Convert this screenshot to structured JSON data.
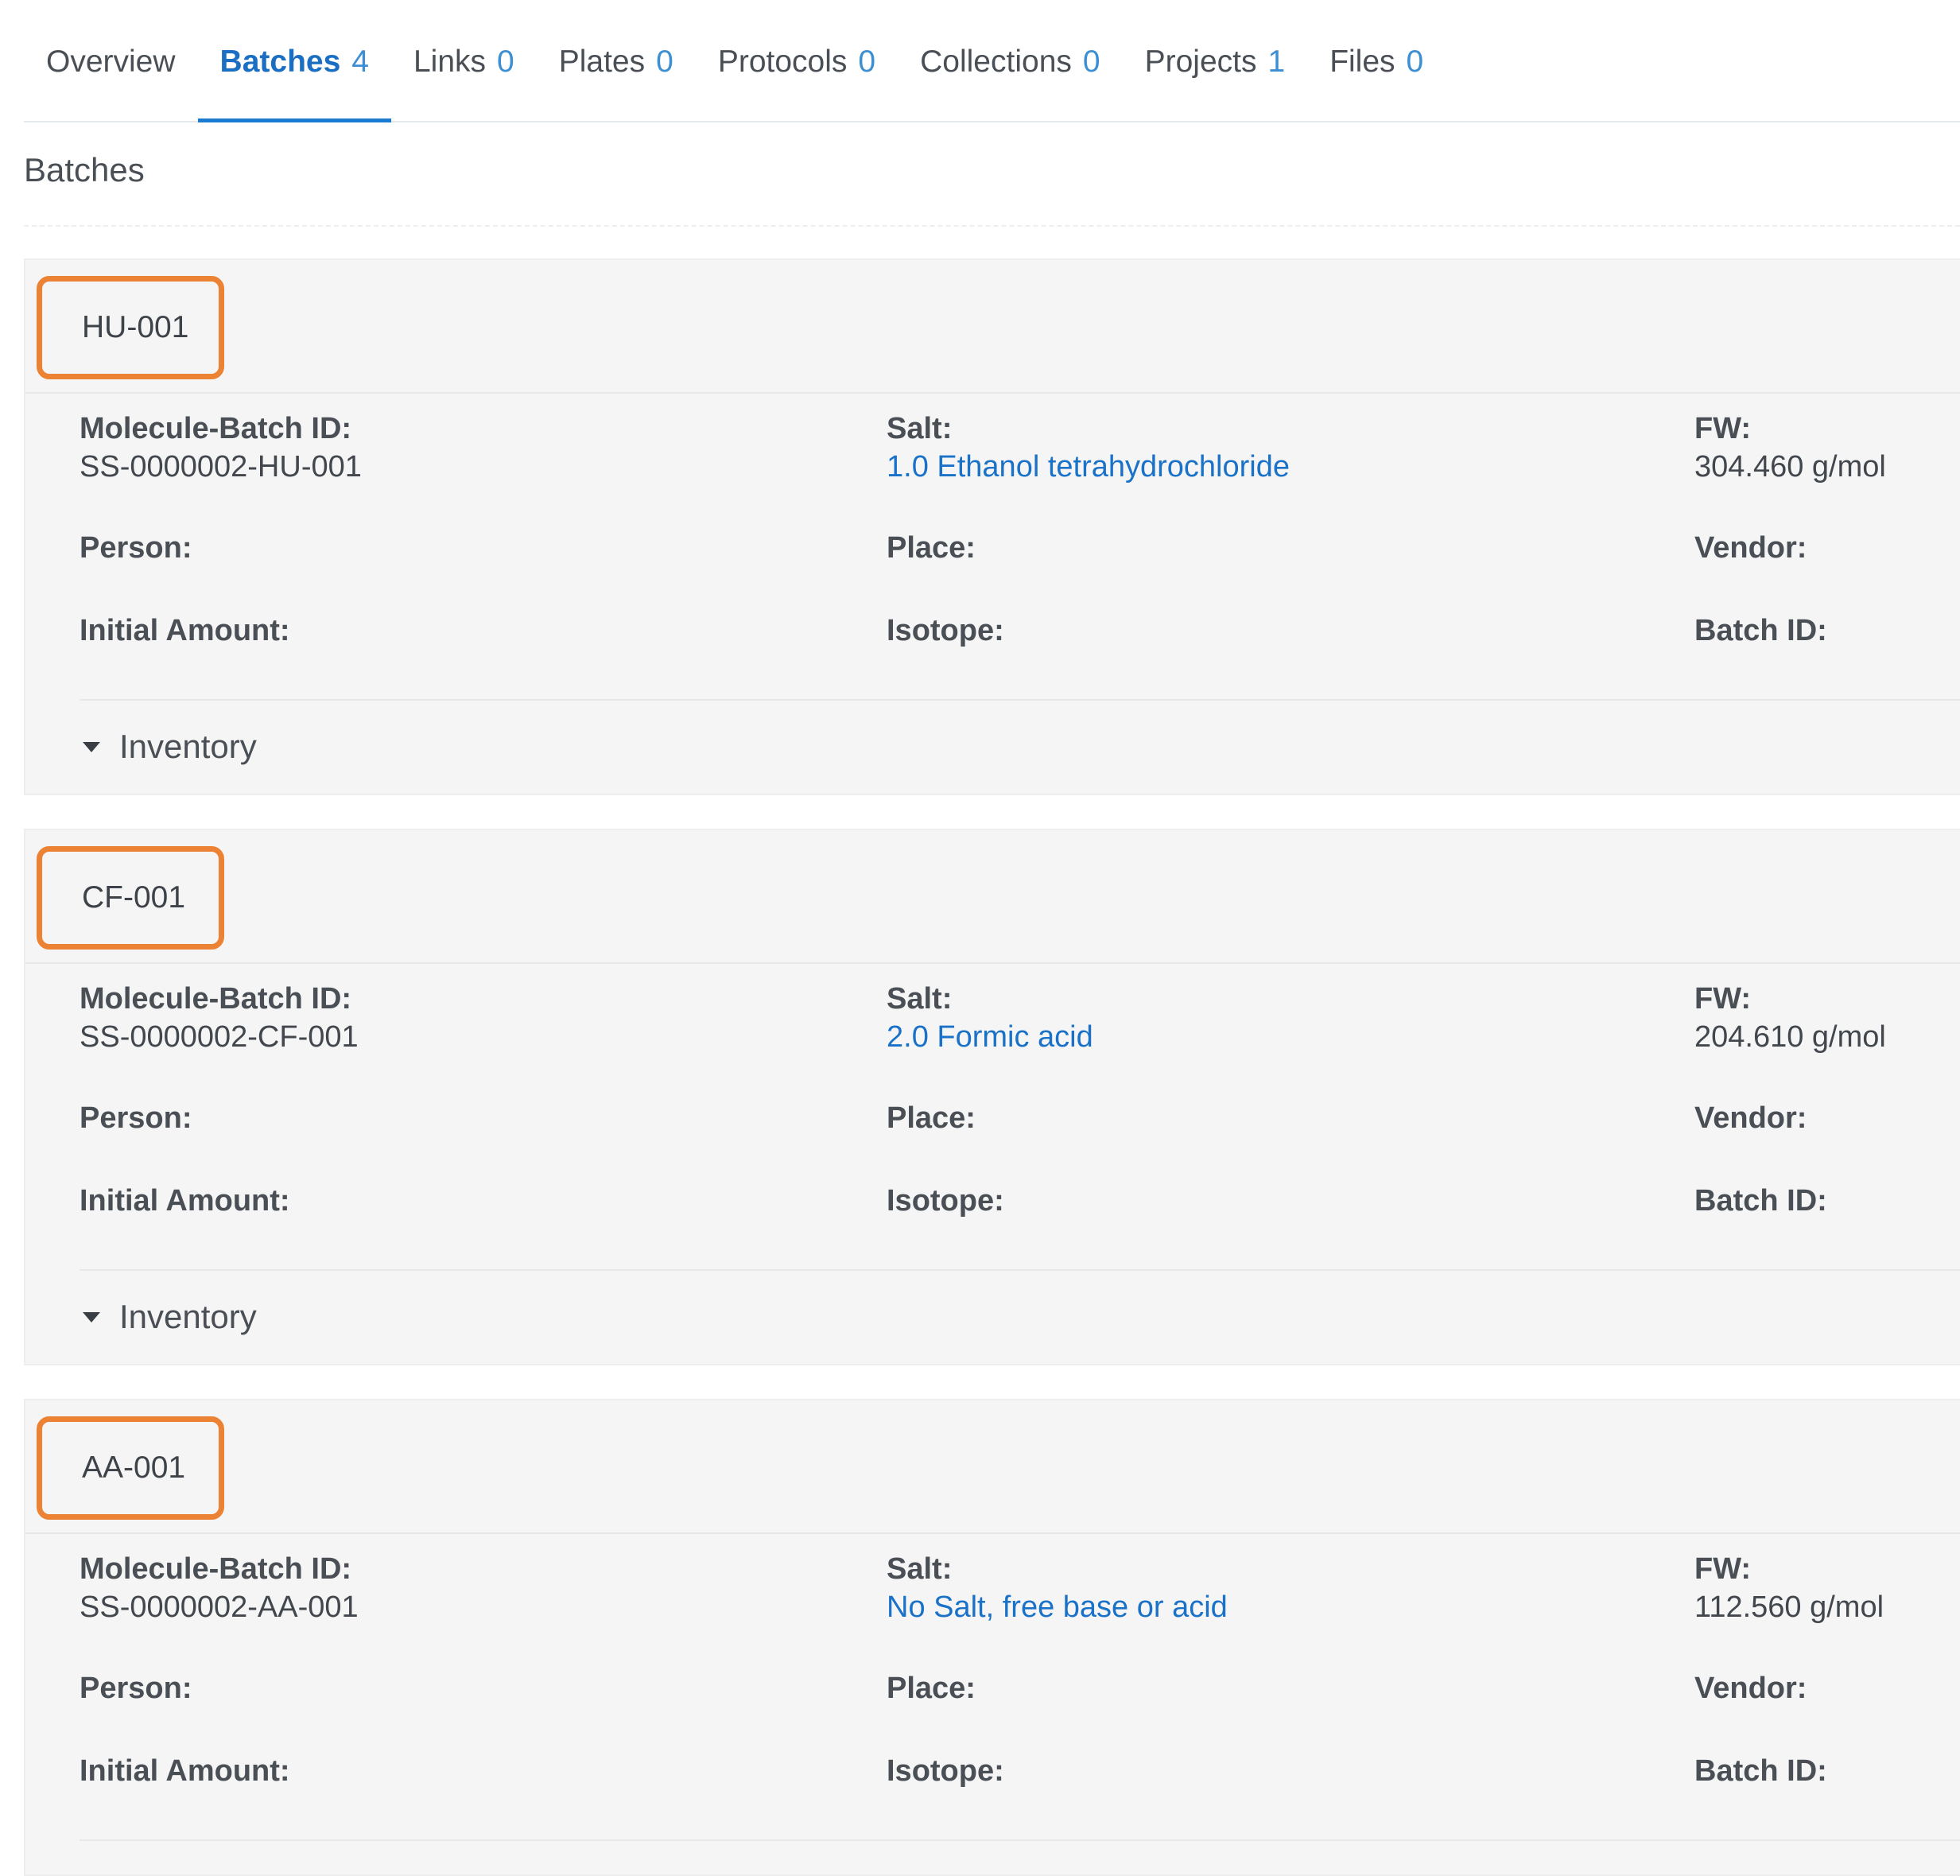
{
  "tabs": [
    {
      "label": "Overview",
      "count": ""
    },
    {
      "label": "Batches",
      "count": "4"
    },
    {
      "label": "Links",
      "count": "0"
    },
    {
      "label": "Plates",
      "count": "0"
    },
    {
      "label": "Protocols",
      "count": "0"
    },
    {
      "label": "Collections",
      "count": "0"
    },
    {
      "label": "Projects",
      "count": "1"
    },
    {
      "label": "Files",
      "count": "0"
    }
  ],
  "active_tab": "Batches",
  "section_title": "Batches",
  "labels": {
    "molecule_batch_id": "Molecule-Batch ID:",
    "salt": "Salt:",
    "fw": "FW:",
    "person": "Person:",
    "place": "Place:",
    "vendor": "Vendor:",
    "initial_amount": "Initial Amount:",
    "isotope": "Isotope:",
    "batch_id": "Batch ID:",
    "inventory": "Inventory"
  },
  "batches": [
    {
      "name": "HU-001",
      "molecule_batch_id": "SS-0000002-HU-001",
      "salt": "1.0 Ethanol tetrahydrochloride",
      "fw": "304.460 g/mol"
    },
    {
      "name": "CF-001",
      "molecule_batch_id": "SS-0000002-CF-001",
      "salt": "2.0 Formic acid",
      "fw": "204.610 g/mol"
    },
    {
      "name": "AA-001",
      "molecule_batch_id": "SS-0000002-AA-001",
      "salt": "No Salt, free base or acid",
      "fw": "112.560 g/mol"
    }
  ],
  "colors": {
    "accent": "#1a7bd0",
    "link": "#1a72c8",
    "highlight_box": "#ec8233",
    "card_bg": "#f5f5f5"
  }
}
